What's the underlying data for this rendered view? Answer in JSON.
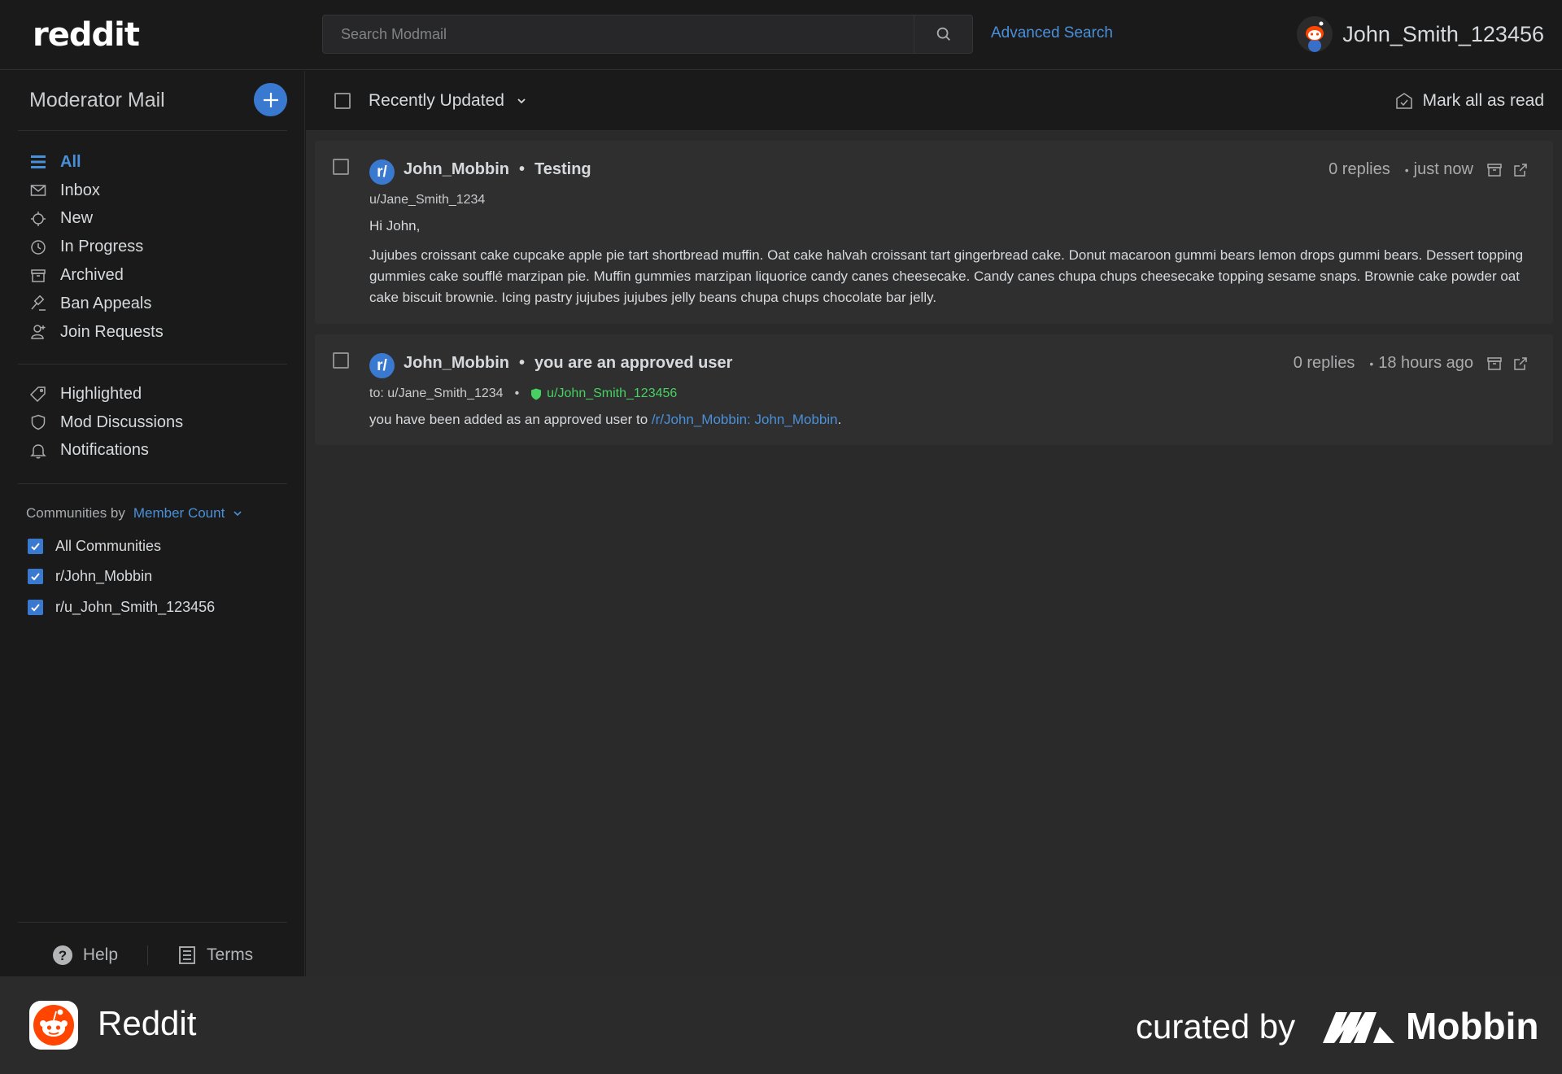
{
  "header": {
    "logo": "reddit",
    "search_placeholder": "Search Modmail",
    "advanced_search": "Advanced Search",
    "username": "John_Smith_123456"
  },
  "sidebar": {
    "title": "Moderator Mail",
    "nav": [
      {
        "label": "All",
        "icon": "list-icon",
        "active": true
      },
      {
        "label": "Inbox",
        "icon": "envelope-icon"
      },
      {
        "label": "New",
        "icon": "sparkle-icon"
      },
      {
        "label": "In Progress",
        "icon": "clock-icon"
      },
      {
        "label": "Archived",
        "icon": "archive-icon"
      },
      {
        "label": "Ban Appeals",
        "icon": "gavel-icon"
      },
      {
        "label": "Join Requests",
        "icon": "add-user-icon"
      }
    ],
    "nav2": [
      {
        "label": "Highlighted",
        "icon": "tag-icon"
      },
      {
        "label": "Mod Discussions",
        "icon": "shield-icon"
      },
      {
        "label": "Notifications",
        "icon": "bell-icon"
      }
    ],
    "communities_by": "Communities by",
    "sort_value": "Member Count",
    "communities": [
      "All Communities",
      "r/John_Mobbin",
      "r/u_John_Smith_123456"
    ],
    "footer": {
      "help": "Help",
      "terms": "Terms"
    }
  },
  "list": {
    "sort_label": "Recently Updated",
    "mark_all_read": "Mark all as read"
  },
  "threads": [
    {
      "avatar": "r/",
      "community": "John_Mobbin",
      "subject": "Testing",
      "replies": "0 replies",
      "time": "just now",
      "author": "u/Jane_Smith_1234",
      "greeting": "Hi John,",
      "body": "Jujubes croissant cake cupcake apple pie tart shortbread muffin. Oat cake halvah croissant tart gingerbread cake. Donut macaroon gummi bears lemon drops gummi bears. Dessert topping gummies cake soufflé marzipan pie. Muffin gummies marzipan liquorice candy canes cheesecake. Candy canes chupa chups cheesecake topping sesame snaps. Brownie cake powder oat cake biscuit brownie. Icing pastry jujubes jujubes jelly beans chupa chups chocolate bar jelly."
    },
    {
      "avatar": "r/",
      "community": "John_Mobbin",
      "subject": "you are an approved user",
      "replies": "0 replies",
      "time": "18 hours ago",
      "to": "to: u/Jane_Smith_1234",
      "mod_user": "u/John_Smith_123456",
      "body_prefix": "you have been added as an approved user to ",
      "body_link": "/r/John_Mobbin: John_Mobbin",
      "body_suffix": "."
    }
  ],
  "brand": {
    "app_name": "Reddit",
    "curated_by": "curated by",
    "mobbin": "Mobbin"
  },
  "colors": {
    "accent": "#3a79d0",
    "link": "#4a90d9",
    "mod_green": "#46d160",
    "reddit_orange": "#ff4500"
  }
}
